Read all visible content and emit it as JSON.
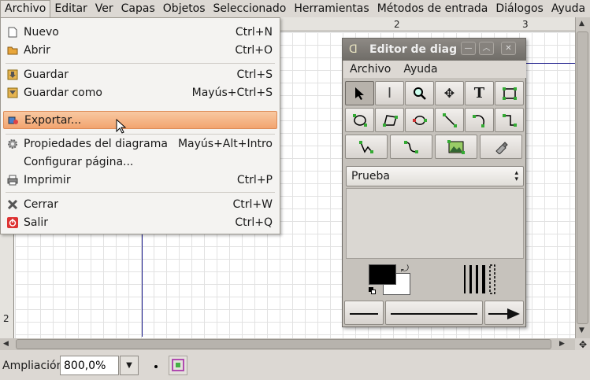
{
  "menubar": {
    "items": [
      "Archivo",
      "Editar",
      "Ver",
      "Capas",
      "Objetos",
      "Seleccionado",
      "Herramientas",
      "Métodos de entrada",
      "Diálogos",
      "Ayuda"
    ]
  },
  "file_menu": {
    "items": [
      {
        "label": "Nuevo",
        "shortcut": "Ctrl+N",
        "icon": "new-document-icon"
      },
      {
        "label": "Abrir",
        "shortcut": "Ctrl+O",
        "icon": "open-folder-icon"
      },
      {
        "label": "Guardar",
        "shortcut": "Ctrl+S",
        "icon": "save-icon"
      },
      {
        "label": "Guardar como",
        "shortcut": "Mayús+Ctrl+S",
        "icon": "save-as-icon"
      },
      {
        "label": "Exportar...",
        "shortcut": "",
        "icon": "export-icon",
        "highlighted": true
      },
      {
        "label": "Propiedades del diagrama",
        "shortcut": "Mayús+Alt+Intro",
        "icon": "gear-icon"
      },
      {
        "label": "Configurar página...",
        "shortcut": "",
        "icon": ""
      },
      {
        "label": "Imprimir",
        "shortcut": "Ctrl+P",
        "icon": "printer-icon"
      },
      {
        "label": "Cerrar",
        "shortcut": "Ctrl+W",
        "icon": "close-icon"
      },
      {
        "label": "Salir",
        "shortcut": "Ctrl+Q",
        "icon": "quit-icon"
      }
    ]
  },
  "ruler": {
    "h_labels": [
      "2",
      "3"
    ],
    "v_labels": [
      "2"
    ]
  },
  "toolbox": {
    "title": "Editor de diag",
    "menu": [
      "Archivo",
      "Ayuda"
    ],
    "sheet": "Prueba"
  },
  "status": {
    "zoom_label": "Ampliación",
    "zoom_value": "800,0%"
  },
  "colors": {
    "menu_highlight": "#f2a46f",
    "title_bar": "#7a7671",
    "guide_line": "#1a1a8a"
  }
}
